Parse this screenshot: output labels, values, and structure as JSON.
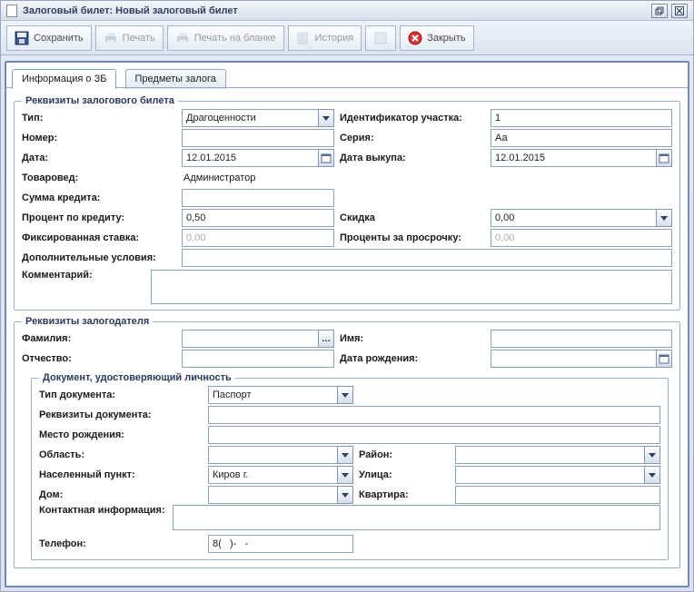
{
  "window": {
    "title": "Залоговый билет:  Новый залоговый билет"
  },
  "toolbar": {
    "save": "Сохранить",
    "print": "Печать",
    "print_blank": "Печать на бланке",
    "history": "История",
    "close": "Закрыть"
  },
  "tabs": {
    "info": "Информация о ЗБ",
    "items": "Предметы залога"
  },
  "ticket": {
    "legend": "Реквизиты залогового билета",
    "labels": {
      "type": "Тип:",
      "site_id": "Идентификатор участка:",
      "number": "Номер:",
      "series": "Серия:",
      "date": "Дата:",
      "redeem": "Дата выкупа:",
      "merch": "Товаровед:",
      "loan": "Сумма кредита:",
      "rate": "Процент по кредиту:",
      "discount": "Скидка",
      "fixed": "Фиксированная ставка:",
      "overdue": "Проценты за просрочку:",
      "extra": "Дополнительные условия:",
      "comment": "Комментарий:"
    },
    "values": {
      "type": "Драгоценности",
      "site_id": "1",
      "number": "",
      "series": "Аа",
      "date": "12.01.2015",
      "redeem": "12.01.2015",
      "merch": "Администратор",
      "loan": "",
      "rate": "0,50",
      "discount": "0,00",
      "fixed": "0,00",
      "overdue": "0,00",
      "extra": "",
      "comment": ""
    }
  },
  "pledger": {
    "legend": "Реквизиты залогодателя",
    "labels": {
      "last": "Фамилия:",
      "first": "Имя:",
      "middle": "Отчество:",
      "dob": "Дата рождения:"
    },
    "values": {
      "last": "",
      "first": "",
      "middle": "",
      "dob": ""
    },
    "doc": {
      "legend": "Документ, удостоверяющий личность",
      "labels": {
        "type": "Тип документа:",
        "details": "Реквизиты документа:",
        "birthplace": "Место рождения:",
        "region": "Область:",
        "district": "Район:",
        "city": "Населенный пункт:",
        "street": "Улица:",
        "house": "Дом:",
        "apt": "Квартира:",
        "contact": "Контактная информация:",
        "phone": "Телефон:"
      },
      "values": {
        "type": "Паспорт",
        "details": "",
        "birthplace": "",
        "region": "",
        "district": "",
        "city": "Киров г.",
        "street": "",
        "house": "",
        "apt": "",
        "contact": "",
        "phone": "8(   )-   -"
      }
    }
  }
}
